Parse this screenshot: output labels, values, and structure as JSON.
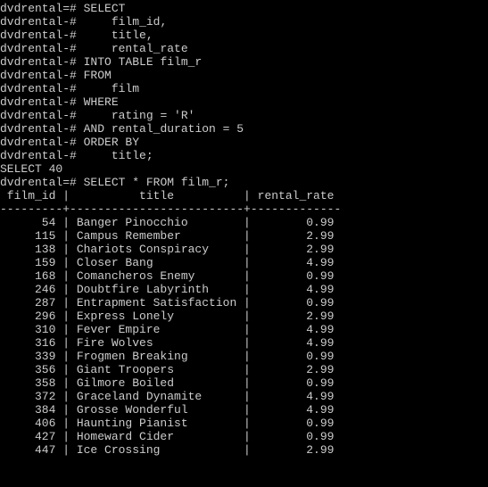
{
  "prompt_main": "dvdrental=# ",
  "prompt_cont": "dvdrental-# ",
  "query1_lines": [
    "SELECT",
    "    film_id,",
    "    title,",
    "    rental_rate",
    "INTO TABLE film_r",
    "FROM",
    "    film",
    "WHERE",
    "    rating = 'R'",
    "AND rental_duration = 5",
    "ORDER BY",
    "    title;"
  ],
  "result1": "SELECT 40",
  "query2": "SELECT * FROM film_r;",
  "header_line": " film_id |          title          | rental_rate",
  "sep_line": "---------+-------------------------+-------------",
  "rows": [
    {
      "film_id": "54",
      "title": "Banger Pinocchio",
      "rate": "0.99"
    },
    {
      "film_id": "115",
      "title": "Campus Remember",
      "rate": "2.99"
    },
    {
      "film_id": "138",
      "title": "Chariots Conspiracy",
      "rate": "2.99"
    },
    {
      "film_id": "159",
      "title": "Closer Bang",
      "rate": "4.99"
    },
    {
      "film_id": "168",
      "title": "Comancheros Enemy",
      "rate": "0.99"
    },
    {
      "film_id": "246",
      "title": "Doubtfire Labyrinth",
      "rate": "4.99"
    },
    {
      "film_id": "287",
      "title": "Entrapment Satisfaction",
      "rate": "0.99"
    },
    {
      "film_id": "296",
      "title": "Express Lonely",
      "rate": "2.99"
    },
    {
      "film_id": "310",
      "title": "Fever Empire",
      "rate": "4.99"
    },
    {
      "film_id": "316",
      "title": "Fire Wolves",
      "rate": "4.99"
    },
    {
      "film_id": "339",
      "title": "Frogmen Breaking",
      "rate": "0.99"
    },
    {
      "film_id": "356",
      "title": "Giant Troopers",
      "rate": "2.99"
    },
    {
      "film_id": "358",
      "title": "Gilmore Boiled",
      "rate": "0.99"
    },
    {
      "film_id": "372",
      "title": "Graceland Dynamite",
      "rate": "4.99"
    },
    {
      "film_id": "384",
      "title": "Grosse Wonderful",
      "rate": "4.99"
    },
    {
      "film_id": "406",
      "title": "Haunting Pianist",
      "rate": "0.99"
    },
    {
      "film_id": "427",
      "title": "Homeward Cider",
      "rate": "0.99"
    },
    {
      "film_id": "447",
      "title": "Ice Crossing",
      "rate": "2.99"
    }
  ]
}
